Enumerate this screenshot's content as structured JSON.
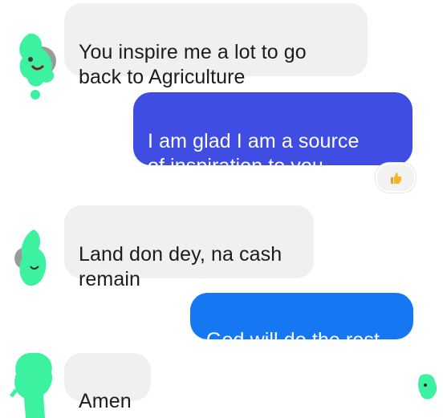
{
  "conversation": {
    "messages": [
      {
        "sender": "them",
        "text": "You inspire me a lot to go\nback to Agriculture"
      },
      {
        "sender": "me",
        "text": "I am glad I am a source\nof inspiration to you"
      },
      {
        "sender": "them",
        "text": "Land don dey, na cash\nremain"
      },
      {
        "sender": "me",
        "text": "God will do the rest"
      },
      {
        "sender": "them",
        "text": "Amen"
      }
    ],
    "reaction": {
      "icon": "thumbs-up-icon",
      "on_message": 2
    }
  },
  "colors": {
    "outgoing_bubble_1": "#3f4de3",
    "outgoing_bubble_2": "#1677f2",
    "incoming_bubble": "#f0f0f0",
    "avatar_redaction": "#3cf2a0",
    "reaction_thumb": "#f6b521"
  }
}
